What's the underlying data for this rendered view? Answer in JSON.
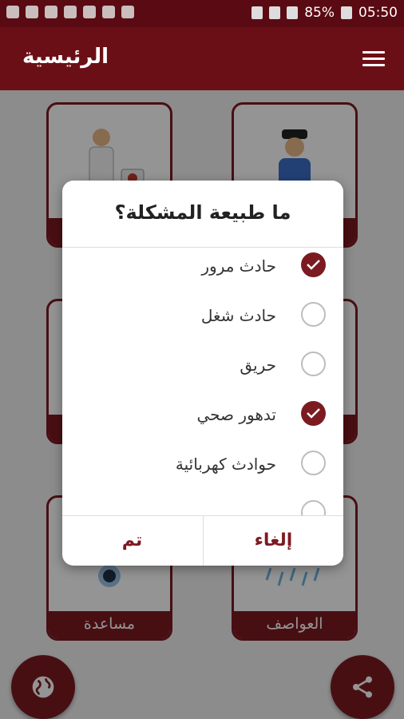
{
  "status_bar": {
    "battery": "85%",
    "time": "05:50"
  },
  "app_bar": {
    "title": "الرئيسية"
  },
  "tiles": [
    {
      "label": ""
    },
    {
      "label": ""
    },
    {
      "label": ""
    },
    {
      "label": ""
    },
    {
      "label": "مساعدة"
    },
    {
      "label": "العواصف"
    }
  ],
  "dialog": {
    "title": "ما طبيعة المشكلة؟",
    "options": [
      {
        "label": "حادث مرور",
        "checked": true
      },
      {
        "label": "حادث شغل",
        "checked": false
      },
      {
        "label": "حريق",
        "checked": false
      },
      {
        "label": "تدهور صحي",
        "checked": true
      },
      {
        "label": "حوادث كهربائية",
        "checked": false
      }
    ],
    "cancel_label": "إلغاء",
    "ok_label": "تم"
  },
  "fabs": {
    "left_icon": "globe-icon",
    "right_icon": "share-icon"
  },
  "colors": {
    "primary": "#6b0f16",
    "accent": "#7c1a22"
  }
}
